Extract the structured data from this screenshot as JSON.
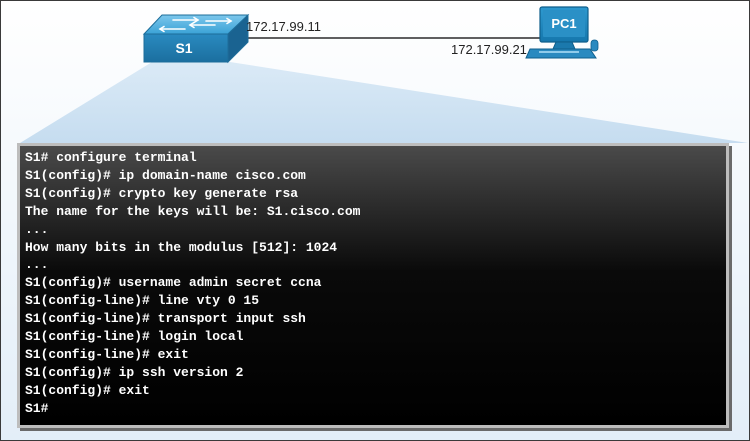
{
  "topology": {
    "switch_label": "S1",
    "switch_ip": "172.17.99.11",
    "pc_label": "PC1",
    "pc_ip": "172.17.99.21"
  },
  "terminal": {
    "lines": [
      "S1# configure terminal",
      "S1(config)# ip domain-name cisco.com",
      "S1(config)# crypto key generate rsa",
      "The name for the keys will be: S1.cisco.com",
      "...",
      "How many bits in the modulus [512]: 1024",
      "...",
      "S1(config)# username admin secret ccna",
      "S1(config-line)# line vty 0 15",
      "S1(config-line)# transport input ssh",
      "S1(config-line)# login local",
      "S1(config-line)# exit",
      "S1(config)# ip ssh version 2",
      "S1(config)# exit",
      "S1#"
    ]
  },
  "colors": {
    "switch_blue": "#2b8fc4",
    "callout_blue": "#cfe3f3",
    "terminal_bg": "#000000",
    "terminal_text": "#ffffff"
  },
  "icons": [
    "switch-icon",
    "pc-icon"
  ]
}
